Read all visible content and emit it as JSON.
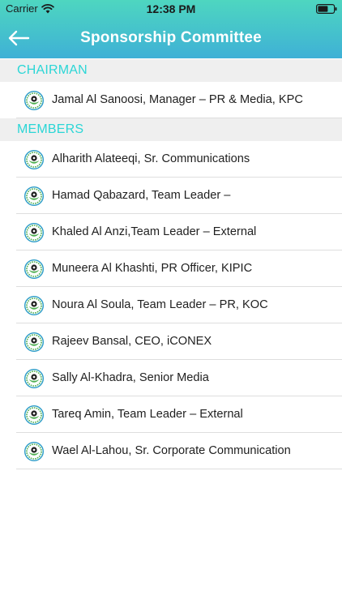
{
  "status_bar": {
    "carrier": "Carrier",
    "time": "12:38 PM"
  },
  "nav": {
    "title": "Sponsorship Committee",
    "back_icon": "arrow-left-icon"
  },
  "colors": {
    "header_gradient_top": "#4ed6c0",
    "header_gradient_bottom": "#3fb0d6",
    "section_text": "#2bd6d6",
    "section_bg": "#efefef"
  },
  "sections": [
    {
      "title": "CHAIRMAN",
      "items": [
        "Jamal Al Sanoosi, Manager – PR & Media, KPC"
      ]
    },
    {
      "title": "MEMBERS",
      "items": [
        "Alharith Alateeqi, Sr. Communications",
        "Hamad Qabazard, Team Leader –",
        "Khaled Al Anzi,Team Leader – External",
        "Muneera Al Khashti, PR Officer, KIPIC",
        "Noura Al Soula, Team Leader – PR, KOC",
        "Rajeev Bansal, CEO, iCONEX",
        "Sally Al-Khadra,  Senior Media",
        "Tareq Amin, Team Leader – External",
        "Wael Al-Lahou, Sr. Corporate Communication"
      ]
    }
  ]
}
